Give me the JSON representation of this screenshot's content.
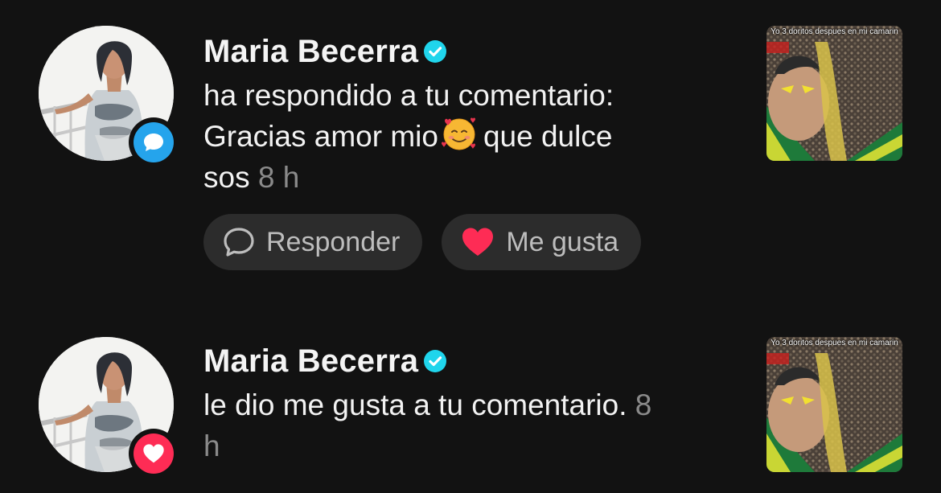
{
  "notifications": [
    {
      "name": "Maria Becerra",
      "message_lines": [
        "ha respondido a tu comentario:",
        "Gracias amor mio",
        "que dulce",
        "sos"
      ],
      "emoji": "smiling-face-with-hearts",
      "time": "8 h",
      "badge": {
        "icon": "comment-bubble-icon",
        "color": "#25a4ec"
      },
      "thumbnail_caption": "Yo 3 doritos despues en mi camarin",
      "actions": [
        {
          "label": "Responder",
          "icon": "speech-bubble-icon"
        },
        {
          "label": "Me gusta",
          "icon": "heart-icon",
          "icon_color": "#fe2c55"
        }
      ]
    },
    {
      "name": "Maria Becerra",
      "message_lines": [
        "le dio me gusta a tu comentario."
      ],
      "time_part1": "8",
      "time_part2": "h",
      "badge": {
        "icon": "heart-icon",
        "color": "#fe2c55"
      },
      "thumbnail_caption": "Yo 3 doritos despues en mi camarin"
    }
  ],
  "colors": {
    "background": "#121212",
    "verified": "#20d5ec",
    "muted": "#8a8a8a",
    "button_bg": "#2c2c2c"
  }
}
